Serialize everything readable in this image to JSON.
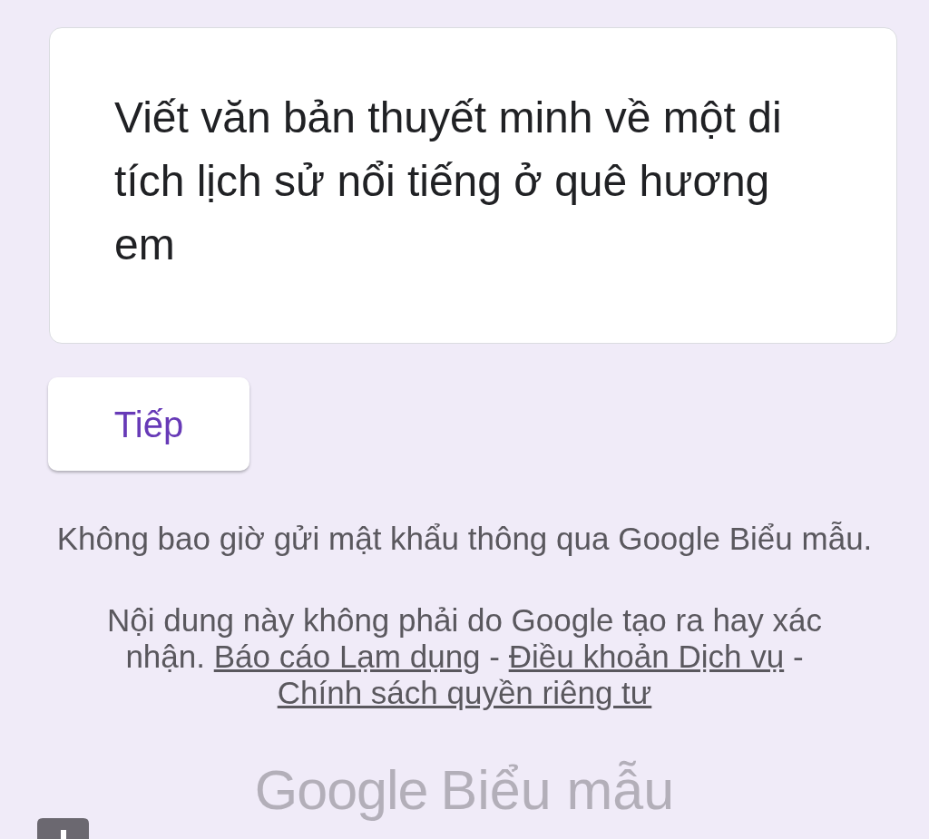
{
  "question_card": {
    "title": "Viết văn bản thuyết minh về một di tích lịch sử nổi tiếng ở quê hương em"
  },
  "next_button": {
    "label": "Tiếp"
  },
  "footer": {
    "notice": "Không bao giờ gửi mật khẩu thông qua Google Biểu mẫu.",
    "disclaimer": {
      "text": "Nội dung này không phải do Google tạo ra hay xác nhận.",
      "links": [
        {
          "label": "Báo cáo Lạm dụng"
        },
        {
          "separator": "-",
          "label": "Điều khoản Dịch vụ"
        },
        {
          "separator": "-",
          "label": "Chính sách quyền riêng tư"
        }
      ]
    },
    "logo": {
      "brand": "Google",
      "product": "Biểu mẫu"
    }
  }
}
